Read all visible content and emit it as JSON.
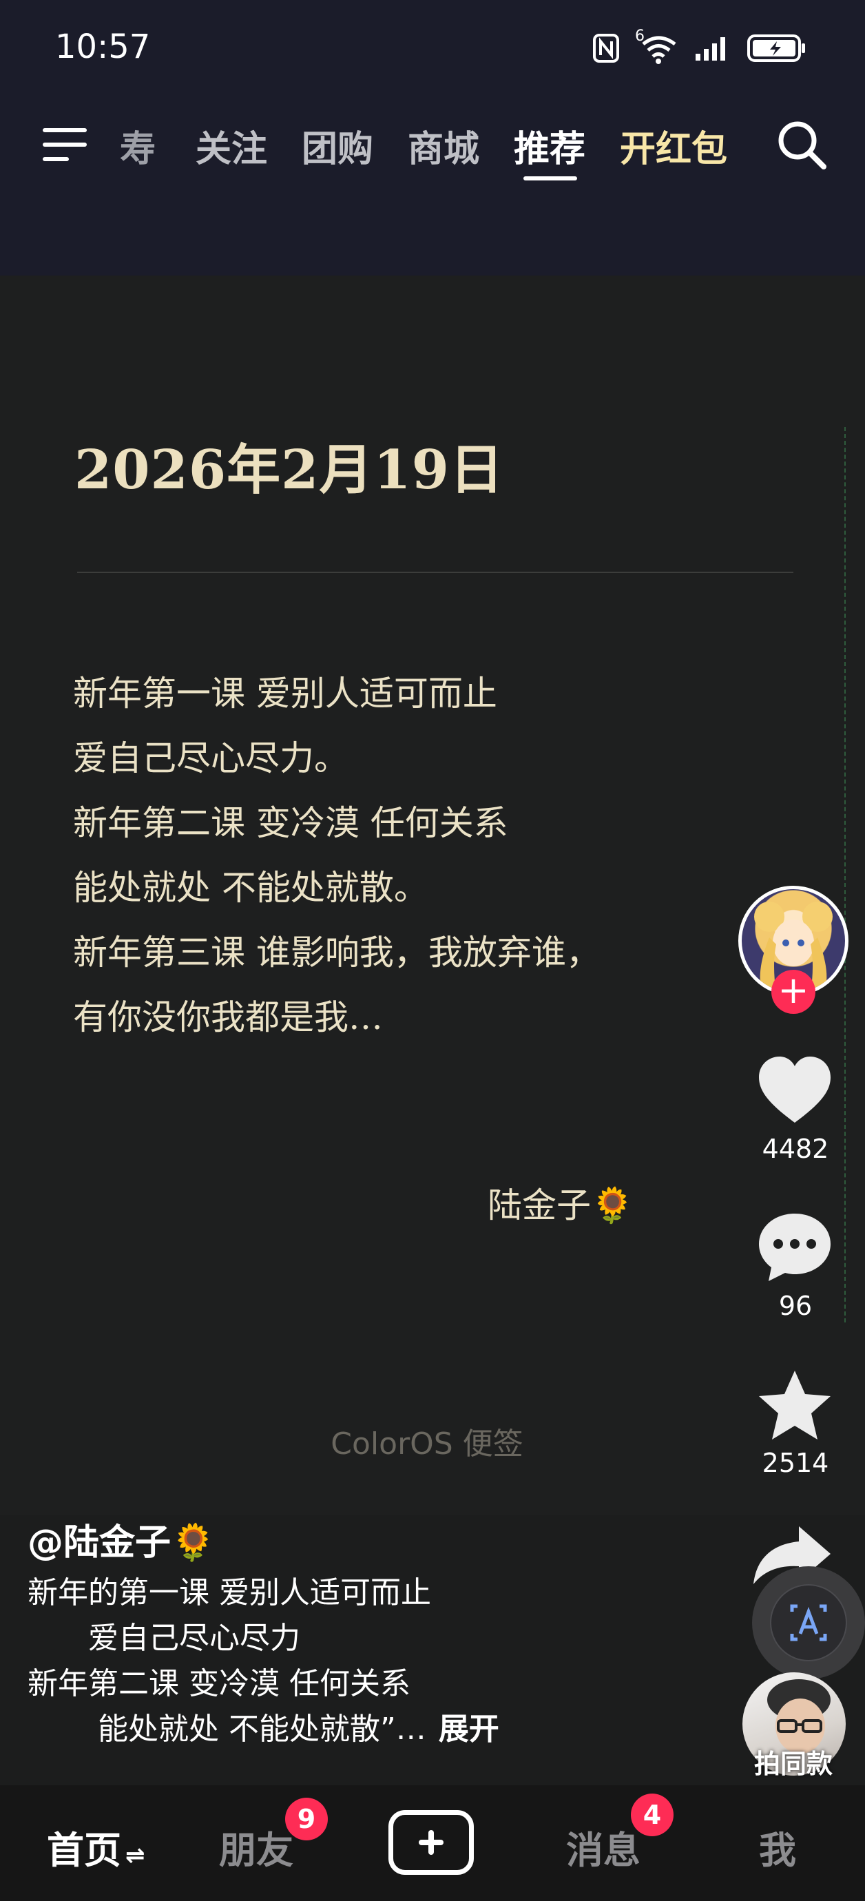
{
  "status_bar": {
    "time": "10:57",
    "network_label": "6"
  },
  "nav": {
    "tabs": [
      "寿",
      "关注",
      "团购",
      "商城",
      "推荐",
      "开红包"
    ],
    "active_tab": "推荐"
  },
  "note": {
    "date": "2026年2月19日",
    "lines": [
      "新年第一课 爱别人适可而止",
      "爱自己尽心尽力。",
      "新年第二课 变冷漠 任何关系",
      "能处就处 不能处就散。",
      "新年第三课 谁影响我，我放弃谁，",
      "有你没你我都是我…"
    ],
    "signature": "陆金子🌻",
    "watermark": "ColorOS 便签"
  },
  "actions": {
    "likes": "4482",
    "comments": "96",
    "favorites": "2514",
    "same_style_label": "拍同款"
  },
  "caption": {
    "author": "@陆金子🌻",
    "lines": [
      "新年的第一课 爱别人适可而止",
      "　　爱自己尽心尽力",
      "新年第二课 变冷漠 任何关系",
      "　　 能处就处 不能处就散”…"
    ],
    "expand_label": "展开"
  },
  "bottom_nav": {
    "home": "首页",
    "friends": "朋友",
    "friends_badge": "9",
    "messages": "消息",
    "messages_badge": "4",
    "me": "我"
  },
  "colors": {
    "header_bg": "#1b1c2a",
    "note_bg": "#1e1f1f",
    "note_text": "#ebe2c6",
    "promo": "#f8e6a8",
    "badge": "#fe2c55"
  }
}
